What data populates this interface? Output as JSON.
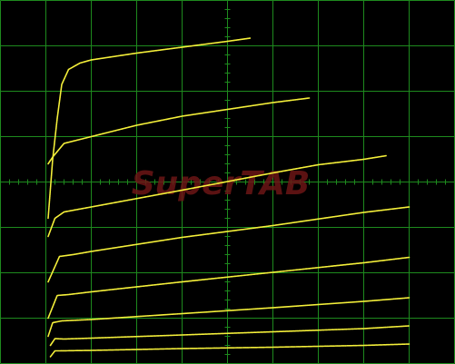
{
  "screen": {
    "background": "#000000",
    "grid_color": "#1e8a1e",
    "trace_color": "#f5f03a",
    "watermark_color": "#6b1616"
  },
  "watermark": {
    "text": "SuperTAB"
  },
  "chart_data": {
    "type": "line",
    "title": "",
    "xlabel": "",
    "ylabel": "",
    "grid": true,
    "graticule": {
      "x_divisions": 10,
      "y_divisions": 8,
      "minor_ticks_per_division": 5
    },
    "xlim": [
      0,
      10
    ],
    "ylim": [
      -4,
      4
    ],
    "series": [
      {
        "points": [
          [
            1.1,
            -3.85
          ],
          [
            1.2,
            -3.72
          ],
          [
            1.3,
            -3.72
          ],
          [
            2,
            -3.71
          ],
          [
            4,
            -3.67
          ],
          [
            6,
            -3.64
          ],
          [
            8,
            -3.6
          ],
          [
            9,
            -3.57
          ]
        ]
      },
      {
        "points": [
          [
            1.1,
            -3.6
          ],
          [
            1.2,
            -3.45
          ],
          [
            1.4,
            -3.46
          ],
          [
            2,
            -3.44
          ],
          [
            4,
            -3.37
          ],
          [
            6,
            -3.3
          ],
          [
            8,
            -3.23
          ],
          [
            9,
            -3.17
          ]
        ]
      },
      {
        "points": [
          [
            1.05,
            -3.4
          ],
          [
            1.15,
            -3.1
          ],
          [
            1.35,
            -3.06
          ],
          [
            2,
            -3.03
          ],
          [
            4,
            -2.9
          ],
          [
            6,
            -2.77
          ],
          [
            8,
            -2.63
          ],
          [
            9,
            -2.55
          ]
        ]
      },
      {
        "points": [
          [
            1.05,
            -3.0
          ],
          [
            1.25,
            -2.5
          ],
          [
            1.5,
            -2.48
          ],
          [
            2,
            -2.42
          ],
          [
            4,
            -2.2
          ],
          [
            6,
            -1.99
          ],
          [
            8,
            -1.78
          ],
          [
            9,
            -1.66
          ]
        ]
      },
      {
        "points": [
          [
            1.05,
            -2.2
          ],
          [
            1.3,
            -1.64
          ],
          [
            1.6,
            -1.6
          ],
          [
            2,
            -1.53
          ],
          [
            4,
            -1.22
          ],
          [
            6,
            -0.96
          ],
          [
            8,
            -0.67
          ],
          [
            9,
            -0.55
          ]
        ]
      },
      {
        "points": [
          [
            1.05,
            -1.2
          ],
          [
            1.2,
            -0.8
          ],
          [
            1.4,
            -0.66
          ],
          [
            2,
            -0.55
          ],
          [
            4,
            -0.18
          ],
          [
            6,
            0.2
          ],
          [
            7,
            0.38
          ],
          [
            8,
            0.5
          ],
          [
            8.5,
            0.58
          ]
        ]
      },
      {
        "points": [
          [
            1.05,
            0.4
          ],
          [
            1.15,
            0.55
          ],
          [
            1.4,
            0.85
          ],
          [
            2,
            1.0
          ],
          [
            3,
            1.25
          ],
          [
            4,
            1.45
          ],
          [
            5,
            1.6
          ],
          [
            6,
            1.75
          ],
          [
            6.8,
            1.85
          ]
        ]
      },
      {
        "points": [
          [
            1.05,
            -0.8
          ],
          [
            1.15,
            0.5
          ],
          [
            1.25,
            1.4
          ],
          [
            1.35,
            2.15
          ],
          [
            1.5,
            2.48
          ],
          [
            1.75,
            2.62
          ],
          [
            2,
            2.69
          ],
          [
            3,
            2.84
          ],
          [
            4,
            2.97
          ],
          [
            5,
            3.1
          ],
          [
            5.5,
            3.17
          ]
        ]
      }
    ]
  }
}
